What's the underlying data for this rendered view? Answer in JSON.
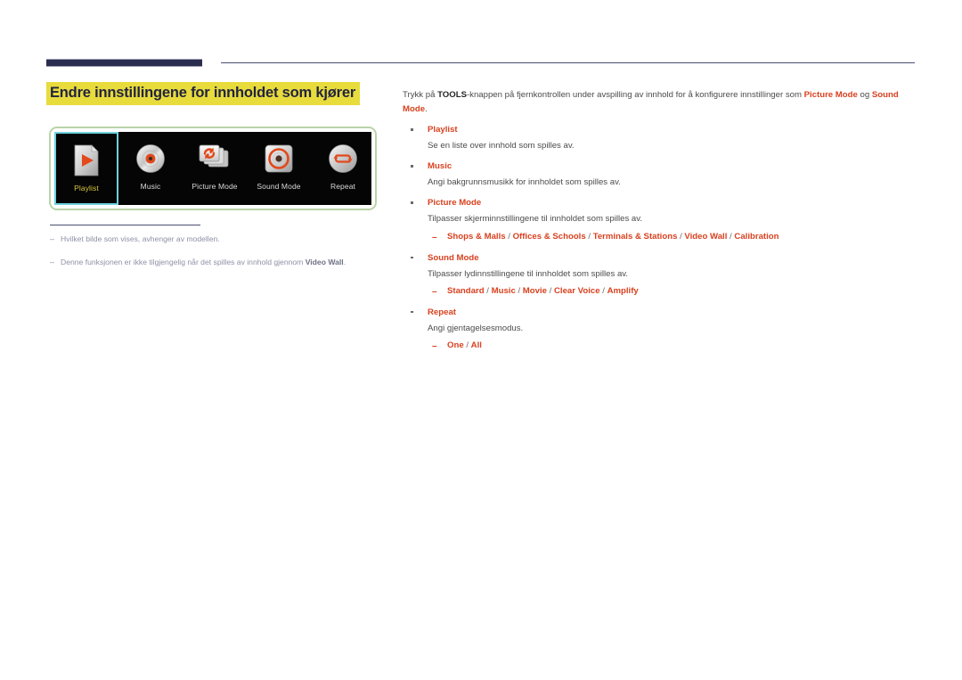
{
  "page": {
    "title": "Endre innstillingene for innholdet som kjører",
    "highlight_color": "#e8db3c",
    "accent_color": "#d8411f",
    "rule_color": "#2b2d4f"
  },
  "device_panel": {
    "border_color": "#b9d4a8",
    "screen_color": "#050505",
    "selection_color": "#6fd2dd",
    "selected_label_color": "#d8c53a",
    "tiles": [
      {
        "label": "Playlist",
        "icon": "playlist-page-play-icon",
        "selected": true
      },
      {
        "label": "Music",
        "icon": "music-disc-icon",
        "selected": false
      },
      {
        "label": "Picture Mode",
        "icon": "picture-mode-cards-refresh-icon",
        "selected": false
      },
      {
        "label": "Sound Mode",
        "icon": "sound-mode-speaker-icon",
        "selected": false
      },
      {
        "label": "Repeat",
        "icon": "repeat-loop-icon",
        "selected": false
      }
    ]
  },
  "footnotes": [
    {
      "dash": "–",
      "text_before": "Hvilket bilde som vises, avhenger av modellen.",
      "bold": "",
      "text_after": ""
    },
    {
      "dash": "–",
      "text_before": "Denne funksjonen er ikke tilgjengelig når det spilles av innhold gjennom ",
      "bold": "Video Wall",
      "text_after": "."
    }
  ],
  "content": {
    "intro": {
      "p1": "Trykk på ",
      "tools": "TOOLS",
      "p2": "-knappen på fjernkontrollen under avspilling av innhold for å konfigurere innstillinger som ",
      "picture_mode": "Picture Mode",
      "p3": " og ",
      "sound_mode": "Sound Mode",
      "p4": "."
    },
    "items": [
      {
        "title": "Playlist",
        "desc": "Se en liste over innhold som spilles av.",
        "options": []
      },
      {
        "title": "Music",
        "desc": "Angi bakgrunnsmusikk for innholdet som spilles av.",
        "options": []
      },
      {
        "title": "Picture Mode",
        "desc": "Tilpasser skjerminnstillingene til innholdet som spilles av.",
        "options": [
          "Shops & Malls",
          "Offices & Schools",
          "Terminals & Stations",
          "Video Wall",
          "Calibration"
        ]
      },
      {
        "title": "Sound Mode",
        "desc": "Tilpasser lydinnstillingene til innholdet som spilles av.",
        "options": [
          "Standard",
          "Music",
          "Movie",
          "Clear Voice",
          "Amplify"
        ]
      },
      {
        "title": "Repeat",
        "desc": "Angi gjentagelsesmodus.",
        "options": [
          "One",
          "All"
        ]
      }
    ]
  }
}
